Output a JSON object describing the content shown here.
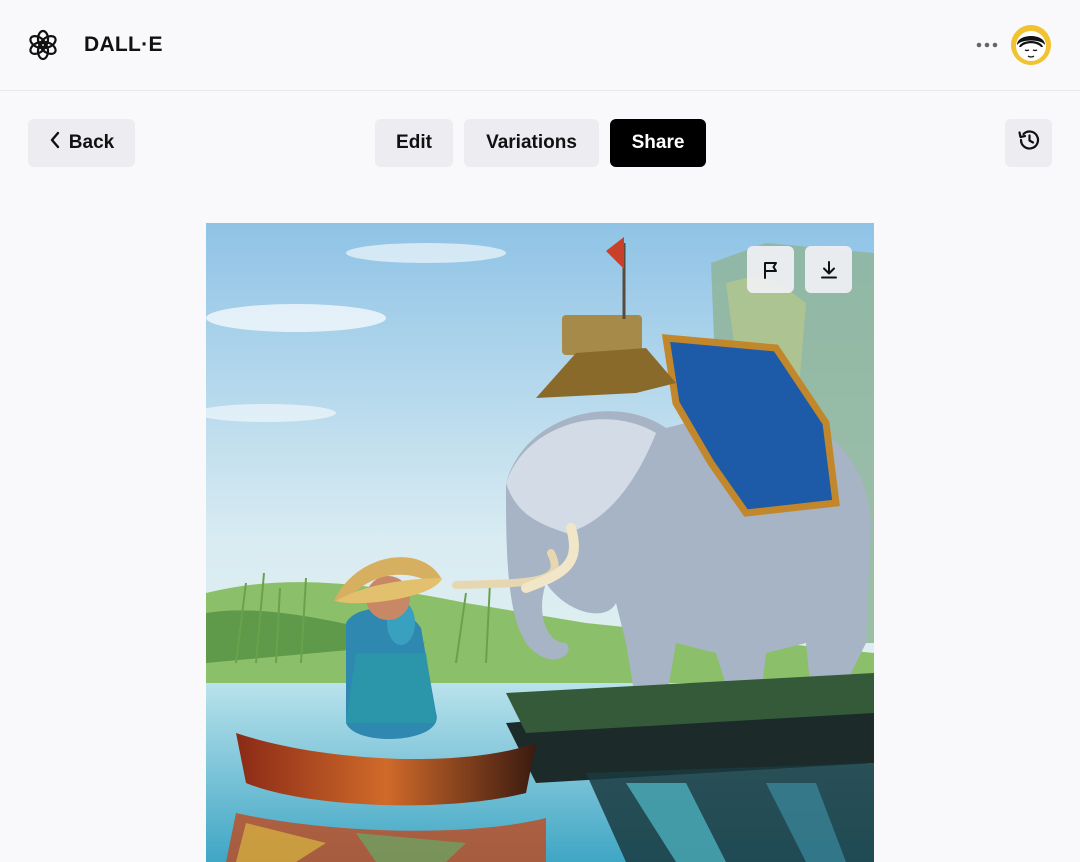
{
  "header": {
    "logo_icon": "openai-logo-icon",
    "brand": "DALL·E",
    "more_icon": "more-horizontal-icon",
    "avatar_icon": "user-avatar"
  },
  "toolbar": {
    "back_label": "Back",
    "back_icon": "chevron-left-icon",
    "edit_label": "Edit",
    "variations_label": "Variations",
    "share_label": "Share",
    "history_icon": "history-icon"
  },
  "image": {
    "subject": "generated-image",
    "flag_icon": "flag-icon",
    "download_icon": "download-icon"
  },
  "colors": {
    "background": "#f9f9fb",
    "button_bg": "#ececf1",
    "share_bg": "#000000",
    "avatar_ring": "#f1c232"
  }
}
